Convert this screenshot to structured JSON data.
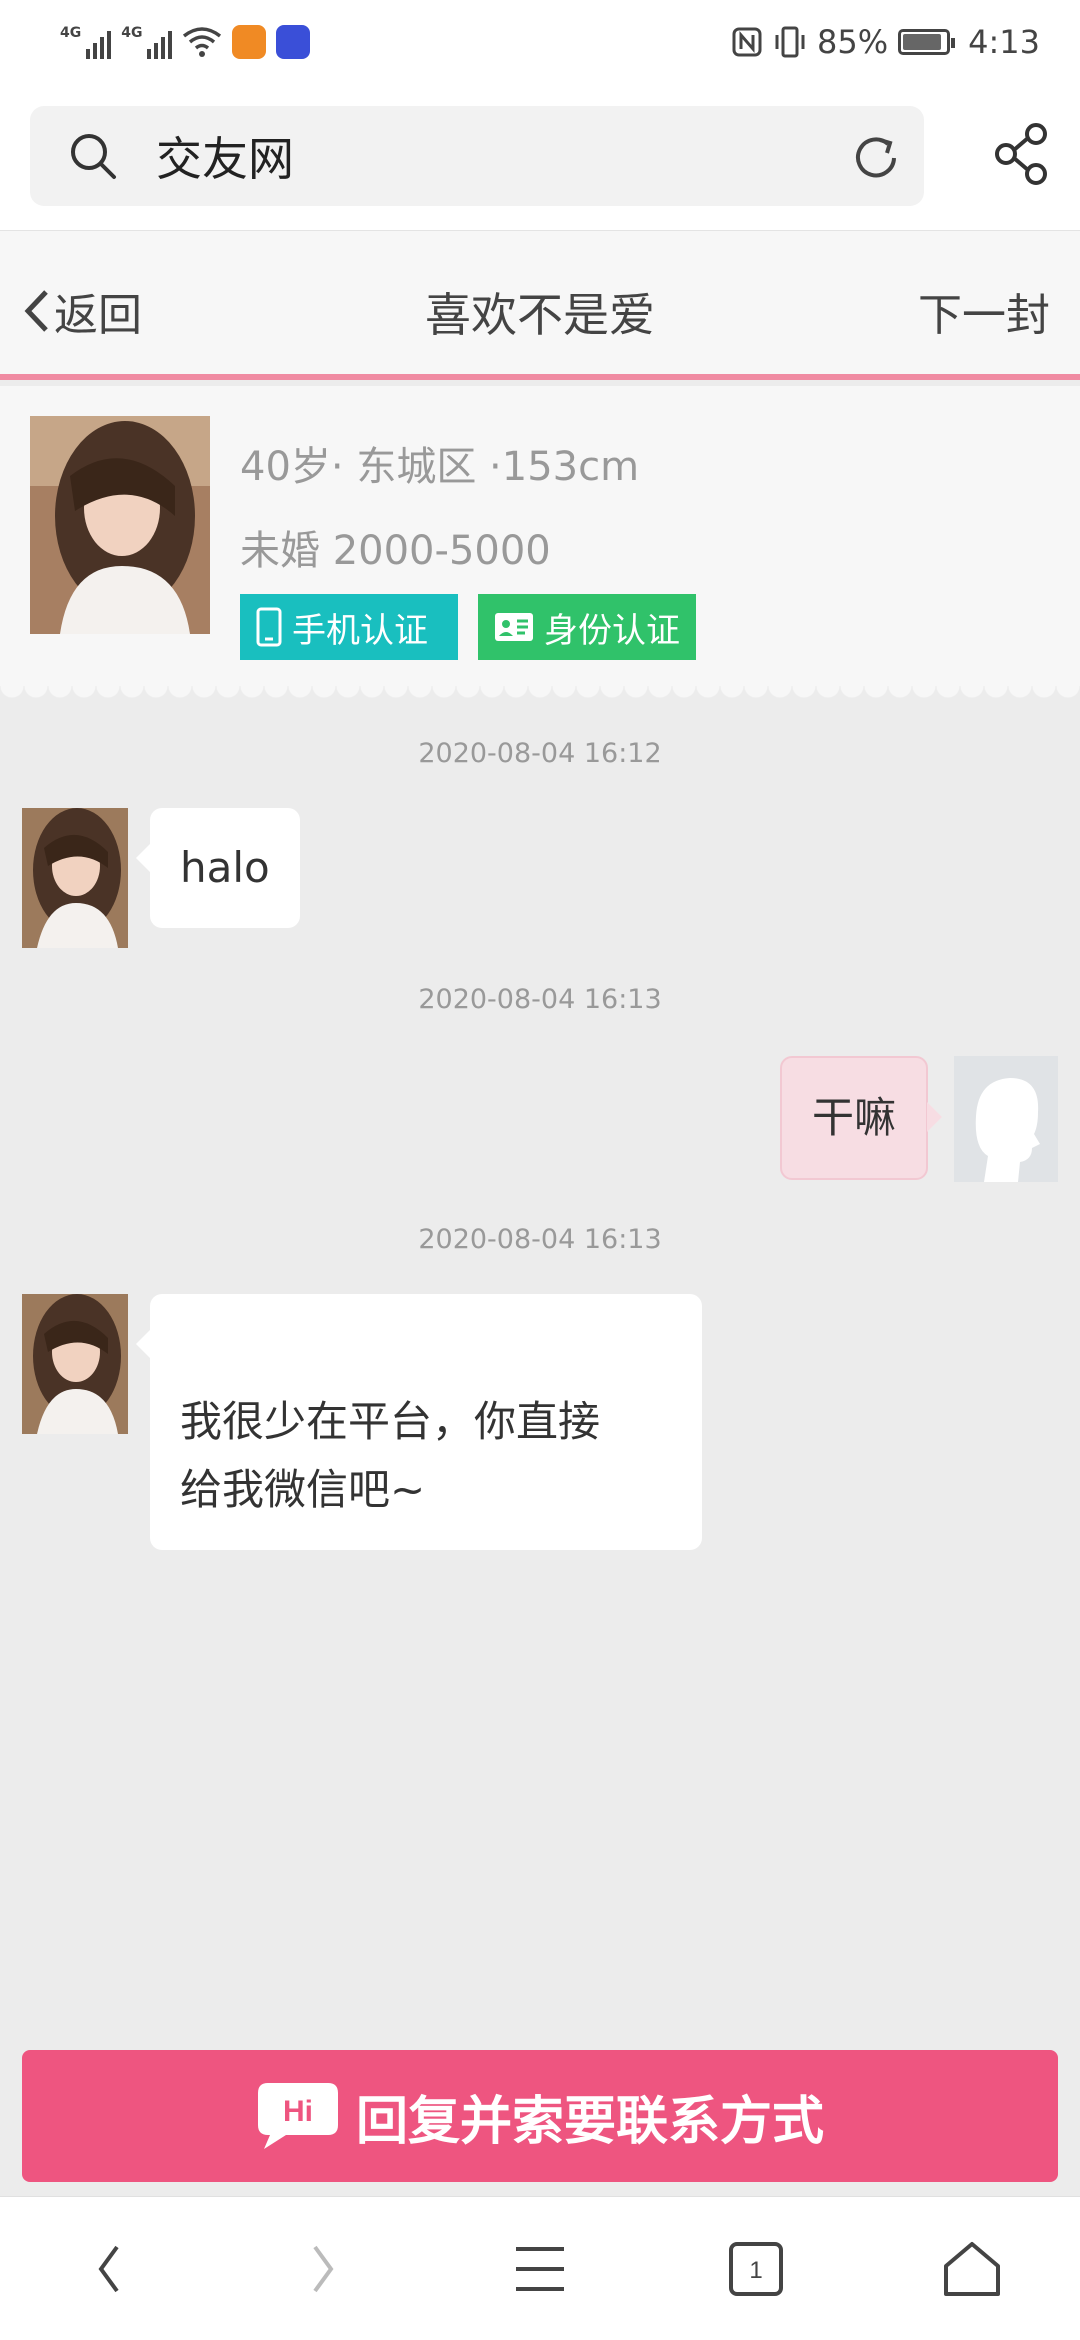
{
  "status_bar": {
    "signal1_label": "4G",
    "signal2_label": "4G",
    "battery_percent": "85%",
    "time": "4:13"
  },
  "browser": {
    "search_query": "交友网"
  },
  "header": {
    "back_label": "返回",
    "title": "喜欢不是爱",
    "next_label": "下一封"
  },
  "profile": {
    "line1": "40岁· 东城区 ·153cm",
    "line2": "未婚 2000-5000",
    "badges": [
      {
        "label": "手机认证",
        "color": "#19bfbf",
        "icon": "phone-icon"
      },
      {
        "label": "身份认证",
        "color": "#30c26a",
        "icon": "id-card-icon"
      }
    ]
  },
  "messages": [
    {
      "timestamp": "2020-08-04 16:12",
      "side": "left",
      "text": "halo"
    },
    {
      "timestamp": "2020-08-04 16:13",
      "side": "right",
      "text": "干嘛"
    },
    {
      "timestamp": "2020-08-04 16:13",
      "side": "left",
      "text": "我很少在平台，你直接\n给我微信吧~"
    }
  ],
  "reply_button": {
    "icon_text": "Hi",
    "label": "回复并索要联系方式",
    "color": "#ee5580"
  },
  "bottom_nav": {
    "tab_count": "1"
  },
  "colors": {
    "accent_pink": "#f08ba2",
    "outgoing_bubble": "#f7dde3"
  }
}
